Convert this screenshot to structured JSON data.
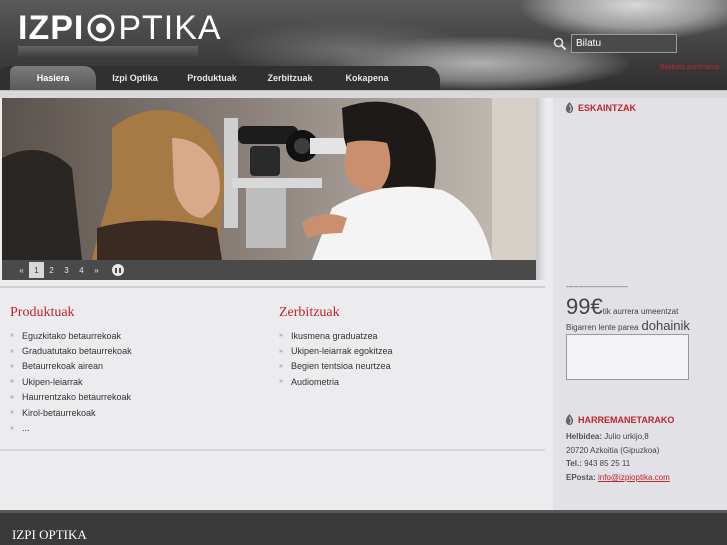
{
  "brand": {
    "logo_bold": "IZPI",
    "logo_light": "PTIKA"
  },
  "search": {
    "value": "Bilatu",
    "advanced_link": "Bilaketa aurreratua"
  },
  "nav": {
    "tabs": [
      "Hasiera",
      "Izpi Optika",
      "Produktuak",
      "Zerbitzuak",
      "Kokapena"
    ],
    "active": "Hasiera"
  },
  "slider": {
    "prev": "«",
    "pages": [
      "1",
      "2",
      "3",
      "4"
    ],
    "next": "»",
    "active_page": "1"
  },
  "produktuak": {
    "title": "Produktuak",
    "items": [
      "Eguzkitako betaurrekoak",
      "Graduatutako betaurrekoak",
      "Betaurrekoak airean",
      "Ukipen-leiarrak",
      "Haurrentzako betaurrekoak",
      "Kirol-betaurrekoak",
      "..."
    ]
  },
  "zerbitzuak": {
    "title": "Zerbitzuak",
    "items": [
      "Ikusmena graduatzea",
      "Ukipen-leiarrak egokitzea",
      "Begien tentsioa neurtzea",
      "Audiometria"
    ]
  },
  "sidebar": {
    "offers_title": "ESKAINTZAK",
    "dashes": "-------------------------",
    "price": "99€",
    "price_suffix": "tik aurrera umeentzat",
    "free_prefix": "Bigarren lente parea",
    "free_word": "dohainik",
    "contact_title": "HARREMANETARAKO",
    "address_label": "Helbidea:",
    "address_line1": "Julio urkijo,8",
    "address_line2": "20720 Azkoitia (Gipuzkoa)",
    "phone_label": "Tel.:",
    "phone": "943 85 25 11",
    "email_label": "EPosta:",
    "email": "info@izpioptika.com"
  },
  "footer": {
    "title": "IZPI OPTIKA"
  },
  "colors": {
    "accent": "#c0232b",
    "header": "#3e3e3e",
    "footer": "#3a3a3a"
  }
}
